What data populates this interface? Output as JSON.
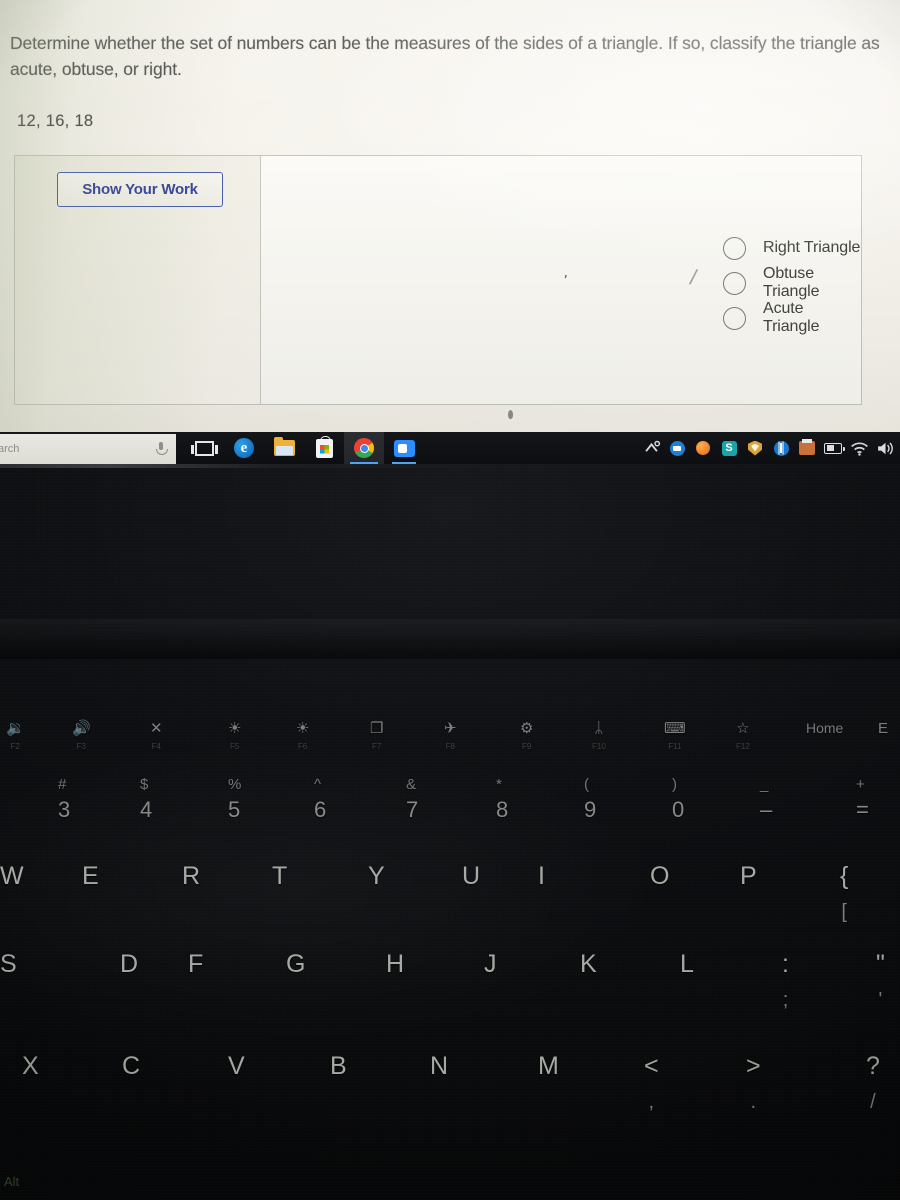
{
  "screen": {
    "question": "Determine whether the set of numbers can be the measures of the sides of a triangle. If so, classify the triangle as acute, obtuse, or right.",
    "numbers": "12, 16, 18",
    "show_work_button": "Show Your Work",
    "options": [
      {
        "label": "Right Triangle",
        "selected": false
      },
      {
        "label": "Obtuse Triangle",
        "selected": false
      },
      {
        "label": "Acute Triangle",
        "selected": false
      }
    ],
    "colors": {
      "background": "#f4f1ea",
      "panel_border": "#c6c6bd",
      "button_accent": "#37479a",
      "text": "#4a4a48"
    }
  },
  "taskbar": {
    "search_value": "arch",
    "search_placeholder": "Type here to search",
    "mic_icon": "microphone-icon",
    "pinned": [
      {
        "name": "task-view-icon",
        "label": "Task View",
        "state": "idle"
      },
      {
        "name": "edge-icon",
        "label": "Microsoft Edge",
        "state": "idle"
      },
      {
        "name": "file-explorer-icon",
        "label": "File Explorer",
        "state": "idle"
      },
      {
        "name": "microsoft-store-icon",
        "label": "Microsoft Store",
        "state": "idle"
      },
      {
        "name": "chrome-icon",
        "label": "Google Chrome",
        "state": "active"
      },
      {
        "name": "zoom-icon",
        "label": "Zoom",
        "state": "open"
      }
    ],
    "tray": [
      {
        "name": "show-hidden-icons-icon",
        "label": "Show hidden icons"
      },
      {
        "name": "blue-app-icon",
        "label": "Messaging app"
      },
      {
        "name": "orange-app-icon",
        "label": "Updater"
      },
      {
        "name": "teal-s-icon",
        "label": "S app"
      },
      {
        "name": "security-shield-icon",
        "label": "Security"
      },
      {
        "name": "bluetooth-icon",
        "label": "Bluetooth"
      },
      {
        "name": "printer-icon",
        "label": "Printer"
      },
      {
        "name": "battery-icon",
        "label": "Battery"
      },
      {
        "name": "wifi-icon",
        "label": "Network"
      },
      {
        "name": "volume-icon",
        "label": "Volume"
      }
    ]
  },
  "keyboard": {
    "function_row": [
      {
        "icon": "volume-down-icon",
        "glyph": "🔉",
        "fn": "F2"
      },
      {
        "icon": "volume-up-icon",
        "glyph": "🔊",
        "fn": "F3"
      },
      {
        "icon": "mute-icon",
        "glyph": "✕",
        "fn": "F4"
      },
      {
        "icon": "brightness-down-icon",
        "glyph": "☀",
        "fn": "F5"
      },
      {
        "icon": "brightness-up-icon",
        "glyph": "☀",
        "fn": "F6"
      },
      {
        "icon": "display-switch-icon",
        "glyph": "❐",
        "fn": "F7"
      },
      {
        "icon": "airplane-mode-icon",
        "glyph": "✈",
        "fn": "F8"
      },
      {
        "icon": "settings-gear-icon",
        "glyph": "⚙",
        "fn": "F9"
      },
      {
        "icon": "bluetooth-icon",
        "glyph": "ᛦ",
        "fn": "F10"
      },
      {
        "icon": "keyboard-backlight-icon",
        "glyph": "⌨",
        "fn": "F11"
      },
      {
        "icon": "favorites-star-icon",
        "glyph": "☆",
        "fn": "F12"
      },
      {
        "icon": "home-key",
        "glyph": "Home",
        "fn": ""
      },
      {
        "icon": "end-key",
        "glyph": "E",
        "fn": ""
      }
    ],
    "number_row": [
      {
        "upper": "#",
        "lower": "3"
      },
      {
        "upper": "$",
        "lower": "4"
      },
      {
        "upper": "%",
        "lower": "5"
      },
      {
        "upper": "^",
        "lower": "6"
      },
      {
        "upper": "&",
        "lower": "7"
      },
      {
        "upper": "*",
        "lower": "8"
      },
      {
        "upper": "(",
        "lower": "9"
      },
      {
        "upper": ")",
        "lower": "0"
      },
      {
        "upper": "_",
        "lower": "–"
      },
      {
        "upper": "+",
        "lower": "="
      }
    ],
    "row_qwerty": [
      "W",
      "E",
      "R",
      "T",
      "Y",
      "U",
      "I",
      "O",
      "P",
      "{"
    ],
    "row_qwerty_sub": [
      "",
      "",
      "",
      "",
      "",
      "",
      "",
      "",
      "",
      "["
    ],
    "row_asdf": [
      "S",
      "D",
      "F",
      "G",
      "H",
      "J",
      "K",
      "L",
      ":",
      "\""
    ],
    "row_asdf_sub": [
      "",
      "",
      "",
      "",
      "",
      "",
      "",
      "",
      ";",
      "'"
    ],
    "row_zxcv": [
      "X",
      "C",
      "V",
      "B",
      "N",
      "M",
      "<",
      ">",
      "?"
    ],
    "row_zxcv_sub": [
      "",
      "",
      "",
      "",
      "",
      "",
      ",",
      ".",
      "/"
    ],
    "alt_key": "Alt"
  }
}
